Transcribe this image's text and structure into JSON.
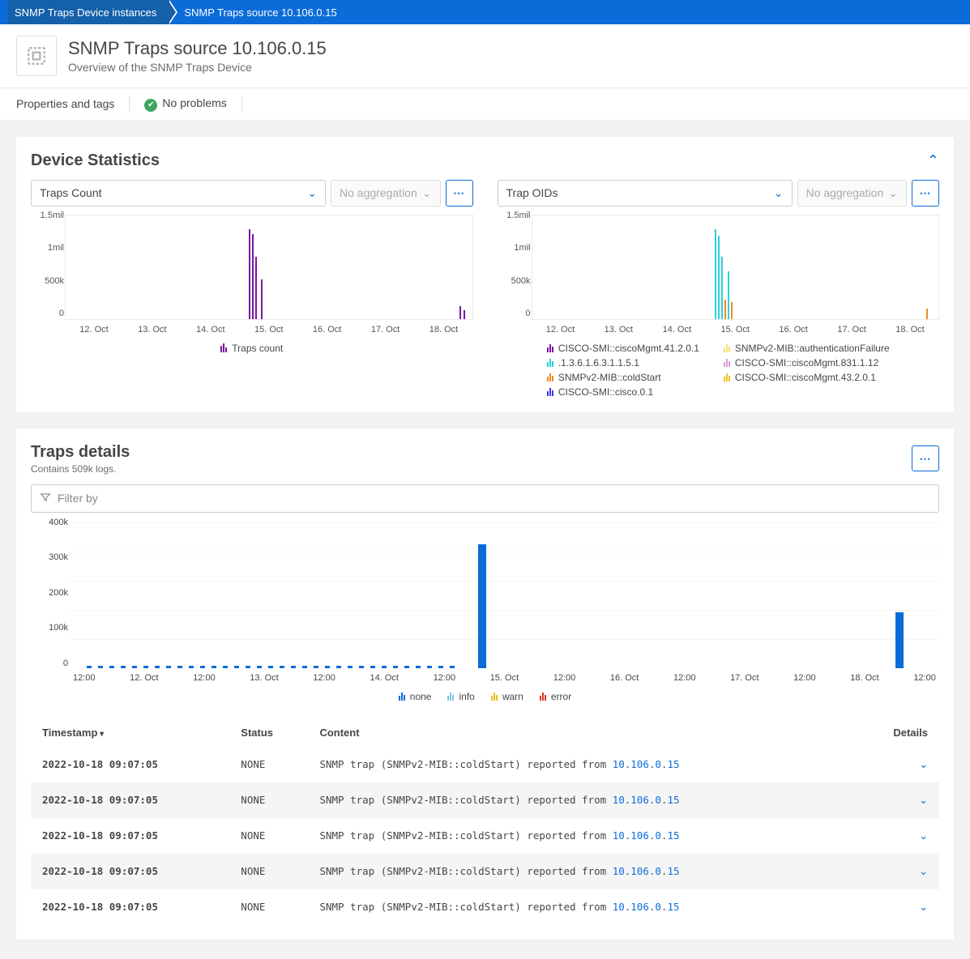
{
  "breadcrumb": {
    "root": "SNMP Traps Device instances",
    "current": "SNMP Traps source 10.106.0.15"
  },
  "header": {
    "title": "SNMP Traps source 10.106.0.15",
    "subtitle": "Overview of the SNMP Traps Device"
  },
  "subbar": {
    "properties": "Properties and tags",
    "status": "No problems"
  },
  "stats": {
    "title": "Device Statistics",
    "chart1": {
      "selector": "Traps Count",
      "agg": "No aggregation",
      "y_ticks": [
        "1.5mil",
        "1mil",
        "500k",
        "0"
      ],
      "x_ticks": [
        "12. Oct",
        "13. Oct",
        "14. Oct",
        "15. Oct",
        "16. Oct",
        "17. Oct",
        "18. Oct"
      ],
      "legend": [
        "Traps count"
      ]
    },
    "chart2": {
      "selector": "Trap OIDs",
      "agg": "No aggregation",
      "y_ticks": [
        "1.5mil",
        "1mil",
        "500k",
        "0"
      ],
      "x_ticks": [
        "12. Oct",
        "13. Oct",
        "14. Oct",
        "15. Oct",
        "16. Oct",
        "17. Oct",
        "18. Oct"
      ],
      "legend": [
        {
          "name": "CISCO-SMI::ciscoMgmt.41.2.0.1",
          "color": "#7b15a1"
        },
        {
          "name": "SNMPv2-MIB::authenticationFailure",
          "color": "#f5e27a"
        },
        {
          "name": ".1.3.6.1.6.3.1.1.5.1",
          "color": "#2ad2db"
        },
        {
          "name": "CISCO-SMI::ciscoMgmt.831.1.12",
          "color": "#d99adb"
        },
        {
          "name": "SNMPv2-MIB::coldStart",
          "color": "#f08c1e"
        },
        {
          "name": "CISCO-SMI::ciscoMgmt.43.2.0.1",
          "color": "#e6c21a"
        },
        {
          "name": "CISCO-SMI::cisco.0.1",
          "color": "#3b3be0"
        }
      ]
    }
  },
  "logs": {
    "title": "Traps details",
    "summary": "Contains 509k logs.",
    "filter_placeholder": "Filter by",
    "y_ticks": [
      "400k",
      "300k",
      "200k",
      "100k",
      "0"
    ],
    "x_ticks": [
      "12:00",
      "12. Oct",
      "12:00",
      "13. Oct",
      "12:00",
      "14. Oct",
      "12:00",
      "15. Oct",
      "12:00",
      "16. Oct",
      "12:00",
      "17. Oct",
      "12:00",
      "18. Oct",
      "12:00"
    ],
    "legend": [
      {
        "name": "none",
        "color": "#0b6cd9"
      },
      {
        "name": "info",
        "color": "#7ec6e8"
      },
      {
        "name": "warn",
        "color": "#e6c21a"
      },
      {
        "name": "error",
        "color": "#d93a2f"
      }
    ],
    "columns": {
      "ts": "Timestamp",
      "status": "Status",
      "content": "Content",
      "details": "Details"
    },
    "rows": [
      {
        "ts": "2022-10-18 09:07:05",
        "status": "NONE",
        "content_pre": "SNMP trap (SNMPv2-MIB::coldStart) reported from ",
        "ip": [
          "10",
          "106",
          "0",
          "15"
        ]
      },
      {
        "ts": "2022-10-18 09:07:05",
        "status": "NONE",
        "content_pre": "SNMP trap (SNMPv2-MIB::coldStart) reported from ",
        "ip": [
          "10",
          "106",
          "0",
          "15"
        ]
      },
      {
        "ts": "2022-10-18 09:07:05",
        "status": "NONE",
        "content_pre": "SNMP trap (SNMPv2-MIB::coldStart) reported from ",
        "ip": [
          "10",
          "106",
          "0",
          "15"
        ]
      },
      {
        "ts": "2022-10-18 09:07:05",
        "status": "NONE",
        "content_pre": "SNMP trap (SNMPv2-MIB::coldStart) reported from ",
        "ip": [
          "10",
          "106",
          "0",
          "15"
        ]
      },
      {
        "ts": "2022-10-18 09:07:05",
        "status": "NONE",
        "content_pre": "SNMP trap (SNMPv2-MIB::coldStart) reported from ",
        "ip": [
          "10",
          "106",
          "0",
          "15"
        ]
      }
    ]
  },
  "chart_data": [
    {
      "type": "bar",
      "title": "Traps Count",
      "x": [
        "12. Oct",
        "13. Oct",
        "14. Oct",
        "15. Oct",
        "16. Oct",
        "17. Oct",
        "18. Oct"
      ],
      "ylim": [
        0,
        1500000
      ],
      "series": [
        {
          "name": "Traps count",
          "color": "#7b15a1",
          "values": [
            0,
            0,
            0,
            1300000,
            0,
            0,
            150000
          ]
        }
      ],
      "note": "Spike cluster late Oct 14 (~1.3M, ~1.0M, ~0.6M) and small bar Oct 18 ~150k"
    },
    {
      "type": "bar",
      "title": "Trap OIDs",
      "x": [
        "12. Oct",
        "13. Oct",
        "14. Oct",
        "15. Oct",
        "16. Oct",
        "17. Oct",
        "18. Oct"
      ],
      "ylim": [
        0,
        1500000
      ],
      "series": [
        {
          "name": "CISCO-SMI::ciscoMgmt.41.2.0.1",
          "color": "#7b15a1"
        },
        {
          "name": ".1.3.6.1.6.3.1.1.5.1",
          "color": "#2ad2db"
        },
        {
          "name": "SNMPv2-MIB::coldStart",
          "color": "#f08c1e"
        },
        {
          "name": "CISCO-SMI::cisco.0.1",
          "color": "#3b3be0"
        },
        {
          "name": "SNMPv2-MIB::authenticationFailure",
          "color": "#f5e27a"
        },
        {
          "name": "CISCO-SMI::ciscoMgmt.831.1.12",
          "color": "#d99adb"
        },
        {
          "name": "CISCO-SMI::ciscoMgmt.43.2.0.1",
          "color": "#e6c21a"
        }
      ],
      "note": "Cyan spike ~1.3M Oct14-15, orange short bars ~250k, small orange Oct18"
    },
    {
      "type": "bar",
      "title": "Traps details",
      "x": [
        "11 12:00",
        "12. Oct",
        "12 12:00",
        "13. Oct",
        "13 12:00",
        "14. Oct",
        "14 12:00",
        "15. Oct",
        "15 12:00",
        "16. Oct",
        "16 12:00",
        "17. Oct",
        "17 12:00",
        "18. Oct",
        "18 12:00"
      ],
      "ylim": [
        0,
        400000
      ],
      "series": [
        {
          "name": "none",
          "color": "#0b6cd9",
          "values": [
            0,
            0,
            0,
            0,
            0,
            0,
            340000,
            0,
            0,
            0,
            0,
            0,
            0,
            150000,
            0
          ]
        }
      ],
      "legend": [
        "none",
        "info",
        "warn",
        "error"
      ]
    }
  ]
}
